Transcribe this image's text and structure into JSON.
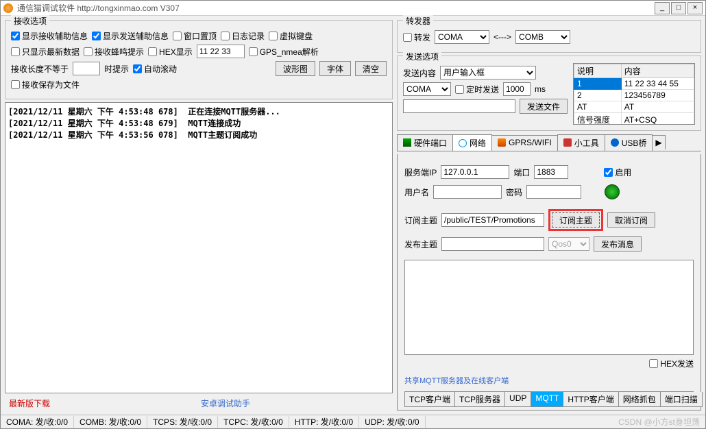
{
  "title": "通信猫调试软件  http://tongxinmao.com   V307",
  "recv": {
    "legend": "接收选项",
    "show_recv_aux": "显示接收辅助信息",
    "show_send_aux": "显示发送辅助信息",
    "window_top": "窗口置顶",
    "log_record": "日志记录",
    "virtual_kb": "虚拟键盘",
    "only_new": "只显示最新数据",
    "beep": "接收蜂鸣提示",
    "hex_disp": "HEX显示",
    "hex_val": "11 22 33",
    "gps": "GPS_nmea解析",
    "len_neq": "接收长度不等于",
    "len_val": "",
    "time_hint": "时提示",
    "auto_scroll": "自动滚动",
    "wave_btn": "波形图",
    "font_btn": "字体",
    "clear_btn": "清空",
    "save_file": "接收保存为文件"
  },
  "log_lines": "[2021/12/11 星期六 下午 4:53:48 678]  正在连接MQTT服务器...\n[2021/12/11 星期六 下午 4:53:48 679]  MQTT连接成功\n[2021/12/11 星期六 下午 4:53:56 078]  MQTT主题订阅成功",
  "links": {
    "latest": "最新版下载",
    "android": "安卓调试助手"
  },
  "fwd": {
    "legend": "转发器",
    "forward": "转发",
    "from": "COMA",
    "arrow": "<--->",
    "to": "COMB"
  },
  "send": {
    "legend": "发送选项",
    "content_lbl": "发送内容",
    "content_sel": "用户输入框",
    "port_sel": "COMA",
    "timed": "定时发送",
    "interval": "1000",
    "ms": "ms",
    "send_text": "",
    "send_file_btn": "发送文件",
    "table": {
      "h1": "说明",
      "h2": "内容",
      "rows": [
        {
          "a": "1",
          "b": "11 22 33 44 55"
        },
        {
          "a": "2",
          "b": "123456789"
        },
        {
          "a": "AT",
          "b": "AT"
        },
        {
          "a": "信号强度",
          "b": "AT+CSQ"
        }
      ]
    }
  },
  "tabs": {
    "hw": "硬件端口",
    "net": "网络",
    "gprs": "GPRS/WIFI",
    "tool": "小工具",
    "usb": "USB桥"
  },
  "net": {
    "server_ip_lbl": "服务端IP",
    "server_ip": "127.0.0.1",
    "port_lbl": "端口",
    "port": "1883",
    "enable": "启用",
    "user_lbl": "用户名",
    "user": "",
    "pass_lbl": "密码",
    "pass": "",
    "sub_topic_lbl": "订阅主题",
    "sub_topic": "/public/TEST/Promotions",
    "sub_btn": "订阅主题",
    "unsub_btn": "取消订阅",
    "pub_topic_lbl": "发布主题",
    "pub_topic": "",
    "qos": "Qos0",
    "pub_btn": "发布消息",
    "hex_send": "HEX发送",
    "share_link": "共享MQTT服务器及在线客户端"
  },
  "subtabs": {
    "t1": "TCP客户端",
    "t2": "TCP服务器",
    "t3": "UDP",
    "t4": "MQTT",
    "t5": "HTTP客户端",
    "t6": "网络抓包",
    "t7": "端口扫描"
  },
  "status": {
    "coma": "COMA: 发/收:0/0",
    "comb": "COMB: 发/收:0/0",
    "tcps": "TCPS: 发/收:0/0",
    "tcpc": "TCPC: 发/收:0/0",
    "http": "HTTP: 发/收:0/0",
    "udp": "UDP: 发/收:0/0",
    "watermark": "CSDN @小方st身坦荡"
  }
}
